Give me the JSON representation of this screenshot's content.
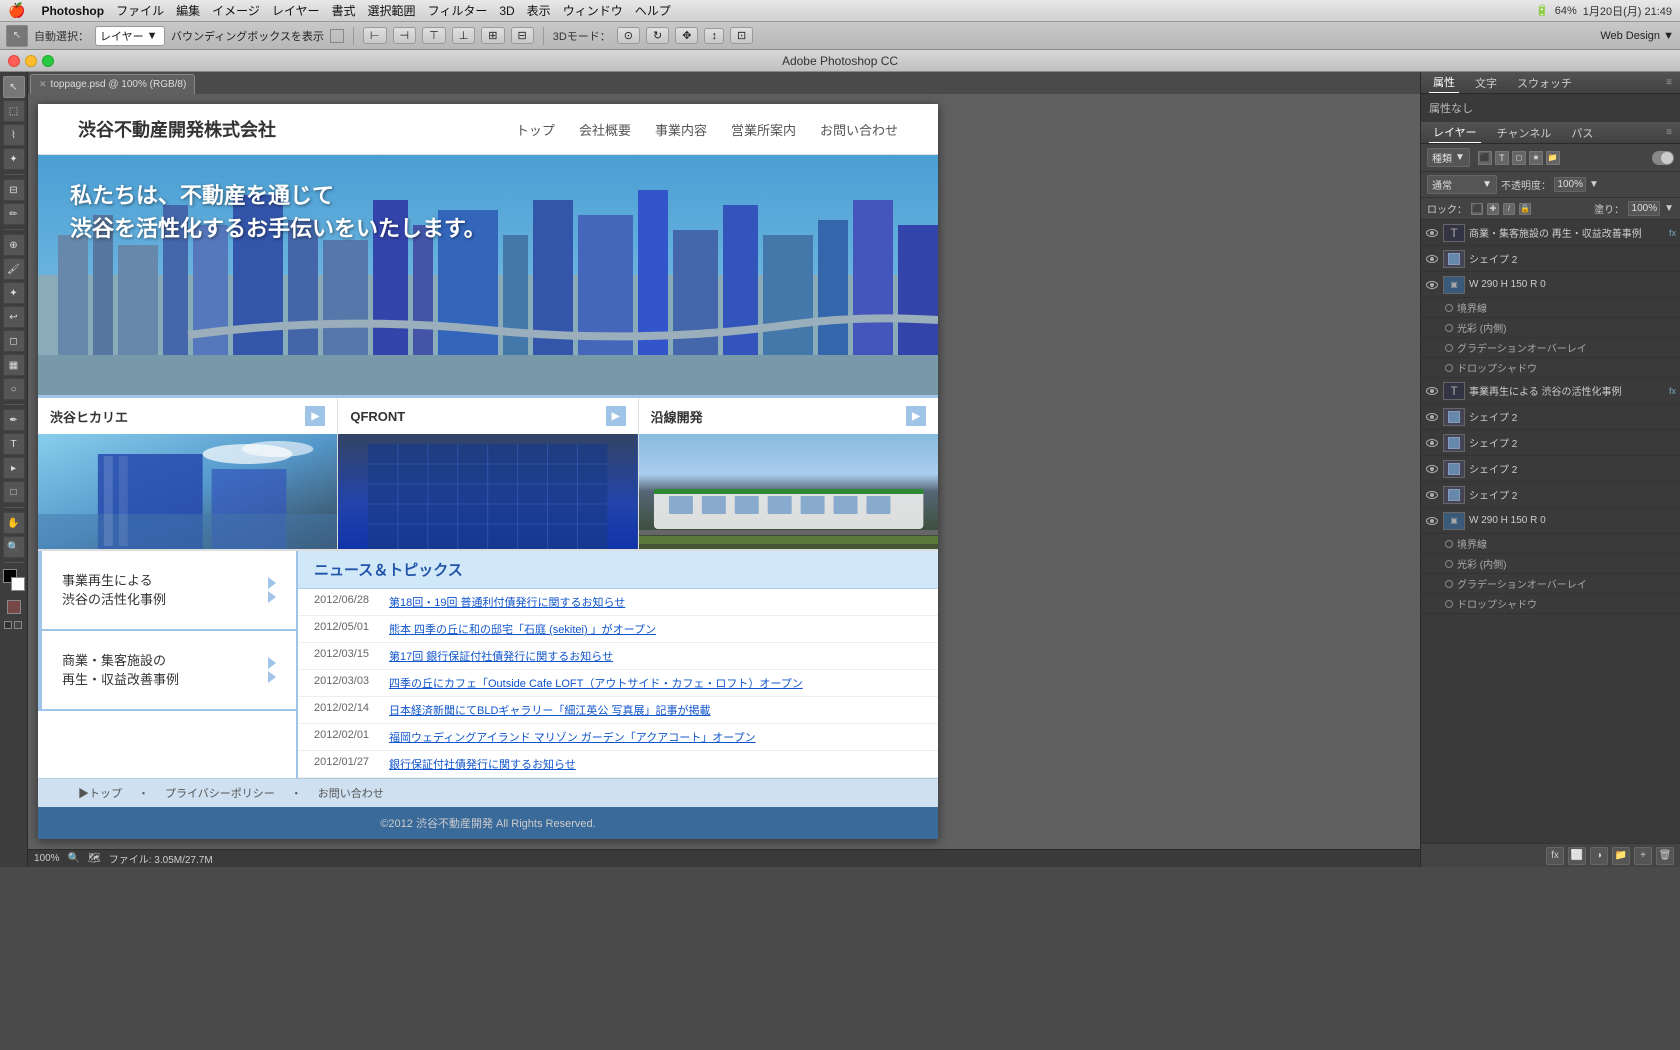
{
  "app": {
    "name": "Photoshop",
    "title": "Adobe Photoshop CC",
    "workspace": "Web Design"
  },
  "menubar": {
    "apple": "🍎",
    "menus": [
      "Photoshop",
      "ファイル",
      "編集",
      "イメージ",
      "レイヤー",
      "書式",
      "選択範囲",
      "フィルター",
      "3D",
      "表示",
      "ウィンドウ",
      "ヘルプ"
    ],
    "right_info": "64%",
    "datetime": "1月20日(月) 21:49"
  },
  "options_bar": {
    "auto_select_label": "自動選択：",
    "layer_label": "レイヤー",
    "bounding_box_label": "バウンディングボックスを表示",
    "mode_3d": "3Dモード："
  },
  "document": {
    "tab_name": "toppage.psd @ 100% (RGB/8)",
    "zoom": "100%",
    "file_info": "ファイル: 3.05M/27.7M"
  },
  "webpage": {
    "company_name": "渋谷不動産開発株式会社",
    "nav": [
      "トップ",
      "会社概要",
      "事業内容",
      "営業所案内",
      "お問い合わせ"
    ],
    "hero_text_line1": "私たちは、不動産を通じて",
    "hero_text_line2": "渋谷を活性化するお手伝いをいたします。",
    "col1_title": "渋谷ヒカリエ",
    "col2_title": "QFRONT",
    "col3_title": "沿線開発",
    "news_header": "ニュース＆トピックス",
    "box1_line1": "事業再生による",
    "box1_line2": "渋谷の活性化事例",
    "box2_line1": "商業・集客施設の",
    "box2_line2": "再生・収益改善事例",
    "news_items": [
      {
        "date": "2012/06/28",
        "text": "第18回・19回 普通利付債発行に関するお知らせ"
      },
      {
        "date": "2012/05/01",
        "text": "熊本 四季の丘に和の邸宅「石庭 (sekitei) 」がオープン"
      },
      {
        "date": "2012/03/15",
        "text": "第17回 銀行保証付社債発行に関するお知らせ"
      },
      {
        "date": "2012/03/03",
        "text": "四季の丘にカフェ「Outside Cafe LOFT（アウトサイド・カフェ・ロフト）オープン"
      },
      {
        "date": "2012/02/14",
        "text": "日本経済新聞にてBLDギャラリー「細江英公 写真展」記事が掲載"
      },
      {
        "date": "2012/02/01",
        "text": "福岡ウェディングアイランド マリゾン ガーデン「アクアコート」オープン"
      },
      {
        "date": "2012/01/27",
        "text": "銀行保証付社債発行に関するお知らせ"
      }
    ],
    "footer_links": [
      "▶トップ",
      "プライバシーポリシー",
      "お問い合わせ"
    ],
    "copyright": "©2012 渋谷不動産開発 All Rights Reserved."
  },
  "right_panel": {
    "top_tabs": [
      "属性",
      "文字",
      "スウォッチ"
    ],
    "attr_text": "属性なし",
    "layers_tabs": [
      "レイヤー",
      "チャンネル",
      "パス"
    ],
    "filter_label": "種類",
    "blend_mode": "通常",
    "opacity_label": "不透明度：",
    "opacity_value": "100%",
    "fill_label": "塗り：",
    "fill_value": "100%",
    "lock_label": "ロック：",
    "layers": [
      {
        "name": "商業・集客施設の 再生・収益改善事例",
        "type": "T",
        "has_fx": true,
        "visible": true,
        "active": false
      },
      {
        "name": "シェイプ 2",
        "type": "shape",
        "has_fx": false,
        "visible": true,
        "active": false
      },
      {
        "name": "W 290 H 150 R 0",
        "type": "group",
        "has_fx": false,
        "visible": true,
        "active": false,
        "sublayers": [
          "境界線",
          "光彩 (内側)",
          "グラデーションオーバーレイ",
          "ドロップシャドウ"
        ]
      },
      {
        "name": "事業再生による 渋谷の活性化事例",
        "type": "T",
        "has_fx": true,
        "visible": true,
        "active": false
      },
      {
        "name": "シェイプ 2",
        "type": "shape",
        "has_fx": false,
        "visible": true,
        "active": false
      },
      {
        "name": "シェイプ 2",
        "type": "shape",
        "has_fx": false,
        "visible": true,
        "active": false
      },
      {
        "name": "シェイプ 2",
        "type": "shape",
        "has_fx": false,
        "visible": true,
        "active": false
      },
      {
        "name": "シェイプ 2",
        "type": "shape",
        "has_fx": false,
        "visible": true,
        "active": false
      },
      {
        "name": "W 290 H 150 R 0",
        "type": "group",
        "has_fx": false,
        "visible": true,
        "active": false,
        "sublayers": [
          "境界線",
          "光彩 (内側)",
          "グラデーションオーバーレイ",
          "ドロップシャドウ"
        ]
      }
    ]
  }
}
